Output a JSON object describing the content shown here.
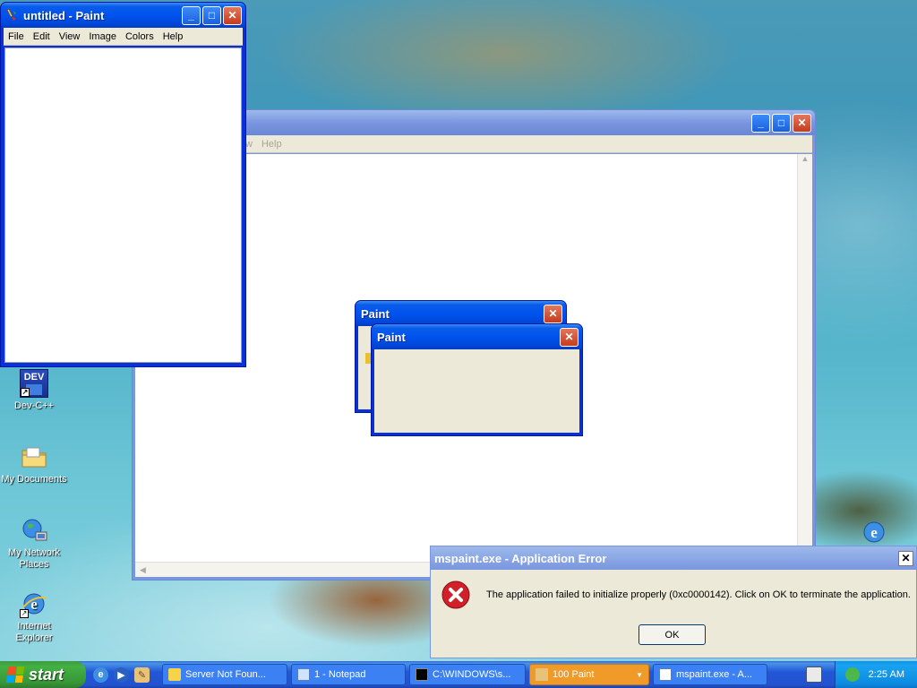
{
  "desktop": {
    "icons": [
      {
        "label": "Dev-C++"
      },
      {
        "label": "My Documents"
      },
      {
        "label": "My Network Places"
      },
      {
        "label": "Internet Explorer"
      }
    ]
  },
  "paint_window": {
    "title": "untitled - Paint",
    "menu": [
      "File",
      "Edit",
      "View",
      "Image",
      "Colors",
      "Help"
    ]
  },
  "background_window": {
    "menu_partial": [
      "w",
      "Help"
    ]
  },
  "paint_dialog_back": {
    "title": "Paint"
  },
  "paint_dialog_front": {
    "title": "Paint"
  },
  "error_dialog": {
    "title": "mspaint.exe - Application Error",
    "message": "The application failed to initialize properly (0xc0000142). Click on OK to terminate the application.",
    "ok_label": "OK",
    "close_label": "✕"
  },
  "taskbar": {
    "start_label": "start",
    "tasks": [
      {
        "label": "Server Not Foun..."
      },
      {
        "label": "1 - Notepad"
      },
      {
        "label": "C:\\WINDOWS\\s..."
      },
      {
        "label": "100 Paint"
      },
      {
        "label": "mspaint.exe - A..."
      }
    ],
    "clock": "2:25 AM"
  },
  "colors": {
    "xp_blue": "#0053ee",
    "start_green": "#379637",
    "flash_orange": "#f09a2a",
    "error_red": "#d0202a"
  }
}
